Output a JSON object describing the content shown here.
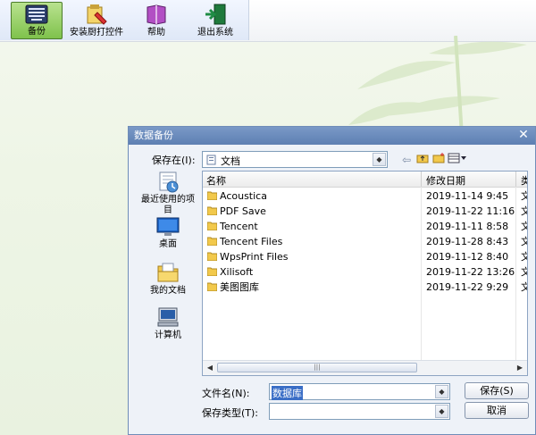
{
  "toolbar": {
    "buttons": [
      {
        "label": "备份",
        "icon": "backup-keyboard-icon"
      },
      {
        "label": "安装厨打控件",
        "icon": "install-plugin-icon"
      },
      {
        "label": "帮助",
        "icon": "help-book-icon"
      },
      {
        "label": "退出系统",
        "icon": "exit-door-icon"
      }
    ]
  },
  "dialog": {
    "title": "数据备份",
    "save_in_label": "保存在(I):",
    "save_in_value": "文档",
    "places": [
      {
        "label": "最近使用的项目",
        "icon": "recent-items-icon"
      },
      {
        "label": "桌面",
        "icon": "desktop-icon"
      },
      {
        "label": "我的文档",
        "icon": "my-documents-icon"
      },
      {
        "label": "计算机",
        "icon": "computer-icon"
      }
    ],
    "columns": {
      "name": "名称",
      "date": "修改日期",
      "type": "类"
    },
    "files": [
      {
        "name": "Acoustica",
        "date": "2019-11-14 9:45",
        "type": "文"
      },
      {
        "name": "PDF Save",
        "date": "2019-11-22 11:16",
        "type": "文"
      },
      {
        "name": "Tencent",
        "date": "2019-11-11 8:58",
        "type": "文"
      },
      {
        "name": "Tencent Files",
        "date": "2019-11-28 8:43",
        "type": "文"
      },
      {
        "name": "WpsPrint Files",
        "date": "2019-11-12 8:40",
        "type": "文"
      },
      {
        "name": "Xilisoft",
        "date": "2019-11-22 13:26",
        "type": "文"
      },
      {
        "name": "美图图库",
        "date": "2019-11-22 9:29",
        "type": "文"
      }
    ],
    "filename_label": "文件名(N):",
    "filename_value": "数据库",
    "filetype_label": "保存类型(T):",
    "filetype_value": "",
    "save_button": "保存(S)",
    "cancel_button": "取消",
    "scroll_grip": "|||"
  }
}
